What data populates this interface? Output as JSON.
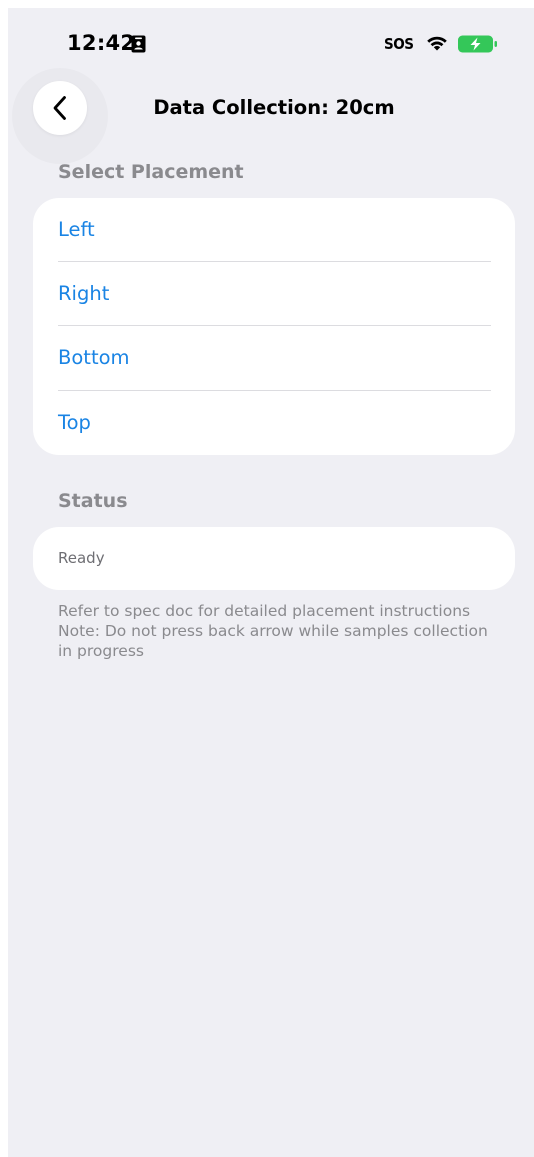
{
  "status_bar": {
    "time": "12:42",
    "carrier": "SOS",
    "battery_color": "#34c759"
  },
  "nav": {
    "title": "Data Collection: 20cm",
    "back_icon": "chevron-left-icon"
  },
  "placement": {
    "header": "Select Placement",
    "options": [
      {
        "label": "Left"
      },
      {
        "label": "Right"
      },
      {
        "label": "Bottom"
      },
      {
        "label": "Top"
      }
    ]
  },
  "status": {
    "header": "Status",
    "value": "Ready"
  },
  "footer": {
    "lines": [
      "Refer to spec doc for detailed placement instructions",
      "Note: Do not press back arrow while samples collection",
      "in progress"
    ]
  },
  "colors": {
    "background": "#efeff4",
    "accent": "#1a84e4",
    "secondary_text": "#8a8a8e"
  }
}
